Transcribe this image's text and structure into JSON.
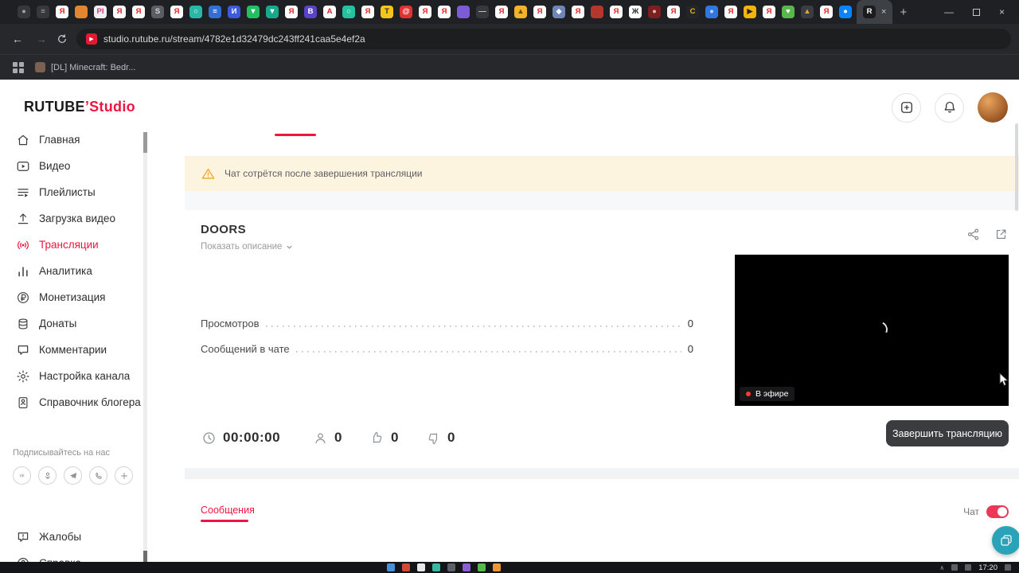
{
  "browser": {
    "url": "studio.rutube.ru/stream/4782e1d32479dc243ff241caa5e4ef2a",
    "bookmark_label": "[DL] Minecraft: Bedr...",
    "active_tab": {
      "g": "R",
      "bg": "#1c1c1e",
      "fg": "#ffffff"
    },
    "tabs": [
      {
        "g": "●",
        "bg": "#36383c",
        "fg": "#9ba1a8"
      },
      {
        "g": "≡",
        "bg": "#36383c",
        "fg": "#9ba1a8"
      },
      {
        "g": "Я",
        "bg": "#ffffff",
        "fg": "#e02222"
      },
      {
        "g": "",
        "bg": "#e2862f",
        "fg": "#ffffff"
      },
      {
        "g": "PI",
        "bg": "#f0f0f2",
        "fg": "#d63a77"
      },
      {
        "g": "Я",
        "bg": "#ffffff",
        "fg": "#e02222"
      },
      {
        "g": "Я",
        "bg": "#ffffff",
        "fg": "#e02222"
      },
      {
        "g": "S",
        "bg": "#5a5e64",
        "fg": "#d5d8db"
      },
      {
        "g": "Я",
        "bg": "#ffffff",
        "fg": "#e02222"
      },
      {
        "g": "○",
        "bg": "#28b8a8",
        "fg": "#ffffff"
      },
      {
        "g": "≡",
        "bg": "#2f6fd6",
        "fg": "#ffffff"
      },
      {
        "g": "И",
        "bg": "#3c5adb",
        "fg": "#ffffff"
      },
      {
        "g": "▼",
        "bg": "#23c063",
        "fg": "#ffffff"
      },
      {
        "g": "▼",
        "bg": "#16a98c",
        "fg": "#ffffff"
      },
      {
        "g": "Я",
        "bg": "#ffffff",
        "fg": "#e02222"
      },
      {
        "g": "B",
        "bg": "#5a43c9",
        "fg": "#ffffff"
      },
      {
        "g": "A",
        "bg": "#ffffff",
        "fg": "#d12323"
      },
      {
        "g": "○",
        "bg": "#25c2a0",
        "fg": "#ffffff"
      },
      {
        "g": "Я",
        "bg": "#ffffff",
        "fg": "#e02222"
      },
      {
        "g": "T",
        "bg": "#f5c518",
        "fg": "#333333"
      },
      {
        "g": "@",
        "bg": "#e23131",
        "fg": "#ffffff"
      },
      {
        "g": "Я",
        "bg": "#ffffff",
        "fg": "#e02222"
      },
      {
        "g": "Я",
        "bg": "#ffffff",
        "fg": "#e02222"
      },
      {
        "g": "",
        "bg": "#7b5cd6",
        "fg": "#ffffff"
      },
      {
        "g": "—",
        "bg": "#36383c",
        "fg": "#c7cbd1"
      },
      {
        "g": "Я",
        "bg": "#ffffff",
        "fg": "#e02222"
      },
      {
        "g": "▲",
        "bg": "#f2b32a",
        "fg": "#6b4a00"
      },
      {
        "g": "Я",
        "bg": "#ffffff",
        "fg": "#e02222"
      },
      {
        "g": "◆",
        "bg": "#6f87b8",
        "fg": "#ffffff"
      },
      {
        "g": "Я",
        "bg": "#ffffff",
        "fg": "#e02222"
      },
      {
        "g": "",
        "bg": "#b3372c",
        "fg": "#ffffff"
      },
      {
        "g": "Я",
        "bg": "#ffffff",
        "fg": "#e02222"
      },
      {
        "g": "Ж",
        "bg": "#ffffff",
        "fg": "#2b2b2b"
      },
      {
        "g": "●",
        "bg": "#7e1f1f",
        "fg": "#e8b3b3"
      },
      {
        "g": "Я",
        "bg": "#ffffff",
        "fg": "#e02222"
      },
      {
        "g": "C",
        "bg": "#23252a",
        "fg": "#f4b40a"
      },
      {
        "g": "●",
        "bg": "#2f78e0",
        "fg": "#bcd6ff"
      },
      {
        "g": "Я",
        "bg": "#ffffff",
        "fg": "#e02222"
      },
      {
        "g": "▶",
        "bg": "#f4b40a",
        "fg": "#222222"
      },
      {
        "g": "Я",
        "bg": "#ffffff",
        "fg": "#e02222"
      },
      {
        "g": "♥",
        "bg": "#57b94c",
        "fg": "#ffffff"
      },
      {
        "g": "▲",
        "bg": "#3a3d42",
        "fg": "#e6a23c"
      },
      {
        "g": "Я",
        "bg": "#ffffff",
        "fg": "#e02222"
      },
      {
        "g": "●",
        "bg": "#0a84ff",
        "fg": "#ffffff"
      }
    ]
  },
  "icons": {
    "back": "←",
    "forward": "→",
    "new_tab": "+",
    "close": "×",
    "minimize": "—",
    "tray_caret": "∧"
  },
  "header": {
    "logo_main": "RUTUBE",
    "logo_tick": "’",
    "logo_accent": "Studio"
  },
  "sidebar": {
    "items": [
      {
        "label": "Главная"
      },
      {
        "label": "Видео"
      },
      {
        "label": "Плейлисты"
      },
      {
        "label": "Загрузка видео"
      },
      {
        "label": "Трансляции"
      },
      {
        "label": "Аналитика"
      },
      {
        "label": "Монетизация"
      },
      {
        "label": "Донаты"
      },
      {
        "label": "Комментарии"
      },
      {
        "label": "Настройка канала"
      },
      {
        "label": "Справочник блогера"
      }
    ],
    "subscribe": "Подписывайтесь на нас",
    "complaints": "Жалобы",
    "help": "Справка"
  },
  "banner": {
    "text": "Чат сотрётся после завершения трансляции"
  },
  "stream": {
    "title": "DOORS",
    "show_description": "Показать описание",
    "stats": [
      {
        "label": "Просмотров",
        "value": "0"
      },
      {
        "label": "Сообщений в чате",
        "value": "0"
      }
    ],
    "duration": "00:00:00",
    "viewers": "0",
    "likes": "0",
    "dislikes": "0",
    "live_label": "В эфире",
    "end_button": "Завершить трансляцию"
  },
  "messages": {
    "tab": "Сообщения",
    "chat_label": "Чат",
    "chat_enabled": true
  },
  "taskbar": {
    "time": "17:20",
    "icons": [
      "#4a90d9",
      "#d04a3a",
      "#e8e8e8",
      "#35b8a0",
      "#5b5f66",
      "#8a5cd6",
      "#57b94c",
      "#e8973a"
    ]
  },
  "colors": {
    "accent": "#ee1540",
    "banner_bg": "#fcf4df",
    "dark_button": "#3a3c40",
    "fab": "#2aa3b8",
    "live_red": "#ff3b30"
  }
}
